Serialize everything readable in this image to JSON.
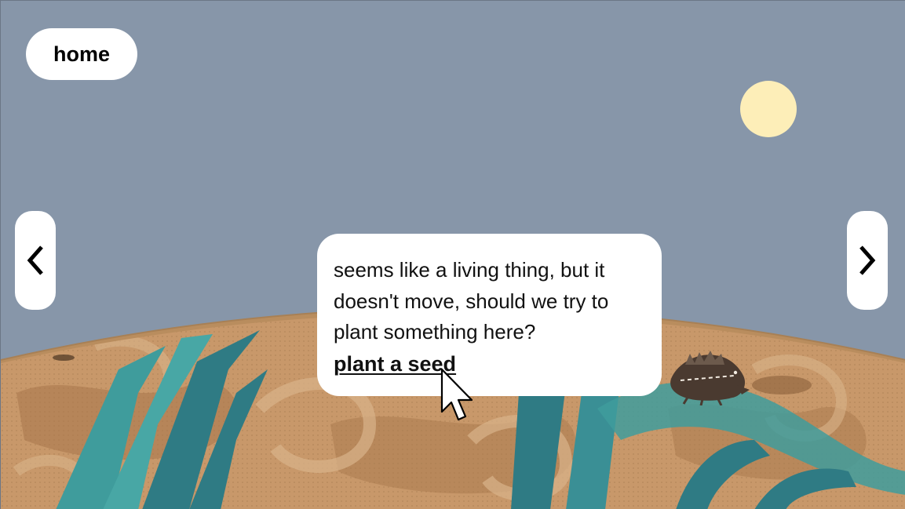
{
  "nav": {
    "home_label": "home",
    "prev_icon": "chevron-left-icon",
    "next_icon": "chevron-right-icon"
  },
  "dialog": {
    "message": "seems like a living thing, but it doesn't move, should we try to plant something here?",
    "action_label": "plant a seed"
  },
  "colors": {
    "sky": "#8796a9",
    "sun": "#fdeeb8",
    "soil": "#c8986a",
    "soil_rim": "#b98d5e",
    "teal": "#3f9c9c",
    "teal_dark": "#2f7b84"
  }
}
